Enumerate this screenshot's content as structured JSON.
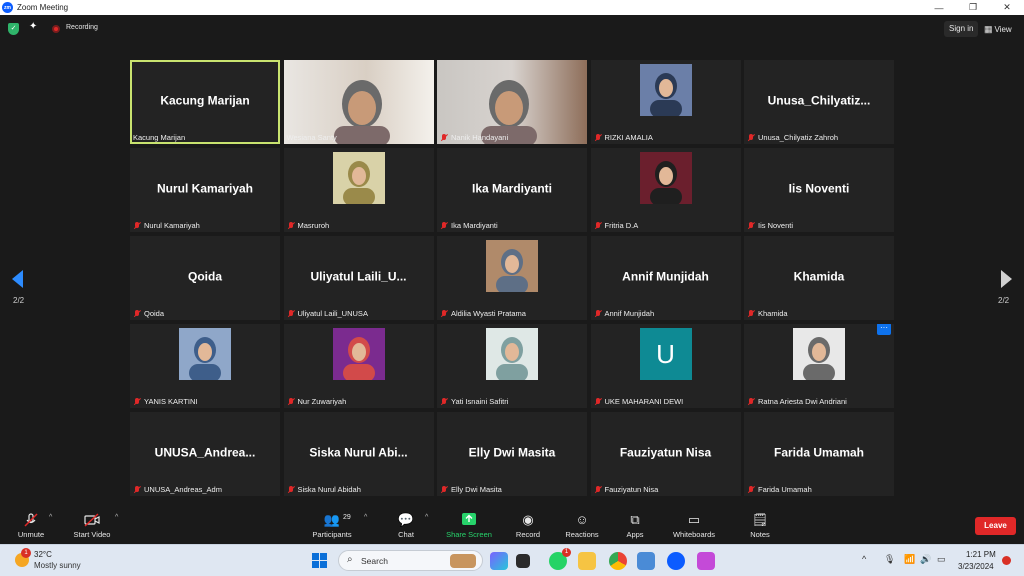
{
  "window": {
    "title": "Zoom Meeting",
    "controls": [
      "—",
      "❐",
      "✕"
    ]
  },
  "topbar": {
    "recording_label": "Recording",
    "signin_label": "Sign in",
    "view_label": "View"
  },
  "pager": {
    "left_label": "2/2",
    "right_label": "2/2"
  },
  "tiles": [
    {
      "big_name": "Kacung Marijan",
      "label": "Kacung Marijan",
      "muted": false,
      "kind": "name",
      "active": true
    },
    {
      "big_name": "",
      "label": "Wesiana Santy",
      "muted": false,
      "kind": "video"
    },
    {
      "big_name": "",
      "label": "Nanik Handayani",
      "muted": true,
      "kind": "video"
    },
    {
      "big_name": "",
      "label": "RIZKI AMALIA",
      "muted": true,
      "kind": "photo"
    },
    {
      "big_name": "Unusa_Chilyatiz...",
      "label": "Unusa_Chilyatiz Zahroh",
      "muted": true,
      "kind": "name"
    },
    {
      "big_name": "Nurul Kamariyah",
      "label": "Nurul Kamariyah",
      "muted": true,
      "kind": "name"
    },
    {
      "big_name": "",
      "label": "Masruroh",
      "muted": true,
      "kind": "photo"
    },
    {
      "big_name": "Ika Mardiyanti",
      "label": "Ika Mardiyanti",
      "muted": true,
      "kind": "name"
    },
    {
      "big_name": "",
      "label": "Fritria D.A",
      "muted": true,
      "kind": "photo"
    },
    {
      "big_name": "Iis Noventi",
      "label": "Iis Noventi",
      "muted": true,
      "kind": "name"
    },
    {
      "big_name": "Qoida",
      "label": "Qoida",
      "muted": true,
      "kind": "name"
    },
    {
      "big_name": "Uliyatul Laili_U...",
      "label": "Uliyatul Laili_UNUSA",
      "muted": true,
      "kind": "name"
    },
    {
      "big_name": "",
      "label": "Aldilia Wyasti Pratama",
      "muted": true,
      "kind": "photo"
    },
    {
      "big_name": "Annif Munjidah",
      "label": "Annif Munjidah",
      "muted": true,
      "kind": "name"
    },
    {
      "big_name": "Khamida",
      "label": "Khamida",
      "muted": true,
      "kind": "name"
    },
    {
      "big_name": "",
      "label": "YANIS KARTINI",
      "muted": true,
      "kind": "photo"
    },
    {
      "big_name": "",
      "label": "Nur Zuwariyah",
      "muted": true,
      "kind": "photo"
    },
    {
      "big_name": "",
      "label": "Yati Isnaini Safitri",
      "muted": true,
      "kind": "photo"
    },
    {
      "big_name": "U",
      "label": "UKE MAHARANI DEWI",
      "muted": true,
      "kind": "initial"
    },
    {
      "big_name": "",
      "label": "Ratna Ariesta Dwi Andriani",
      "muted": true,
      "kind": "photo",
      "more": true
    },
    {
      "big_name": "UNUSA_Andrea...",
      "label": "UNUSA_Andreas_Adm",
      "muted": true,
      "kind": "name"
    },
    {
      "big_name": "Siska Nurul Abi...",
      "label": "Siska Nurul Abidah",
      "muted": true,
      "kind": "name"
    },
    {
      "big_name": "Elly Dwi Masita",
      "label": "Elly Dwi Masita",
      "muted": true,
      "kind": "name"
    },
    {
      "big_name": "Fauziyatun Nisa",
      "label": "Fauziyatun Nisa",
      "muted": true,
      "kind": "name"
    },
    {
      "big_name": "Farida Umamah",
      "label": "Farida Umamah",
      "muted": true,
      "kind": "name"
    }
  ],
  "toolbar": {
    "unmute": "Unmute",
    "start_video": "Start Video",
    "participants": "Participants",
    "participants_count": "29",
    "chat": "Chat",
    "share_screen": "Share Screen",
    "record": "Record",
    "reactions": "Reactions",
    "apps": "Apps",
    "whiteboards": "Whiteboards",
    "notes": "Notes",
    "leave": "Leave"
  },
  "taskbar": {
    "weather_badge": "1",
    "temperature": "32°C",
    "weather_desc": "Mostly sunny",
    "search_placeholder": "Search",
    "whatsapp_badge": "1",
    "time": "1:21 PM",
    "date": "3/23/2024"
  },
  "colors": {
    "active_speaker": "#c9e36f",
    "leave": "#e02828",
    "share": "#27d36b",
    "accent": "#0e72ed"
  }
}
